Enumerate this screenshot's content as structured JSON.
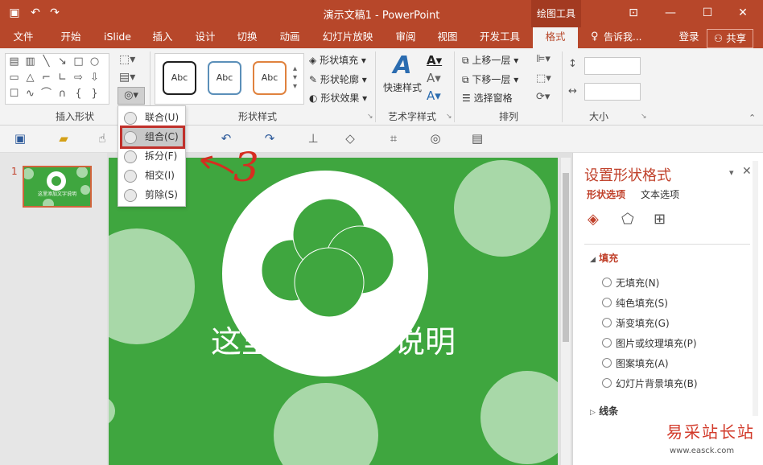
{
  "window": {
    "title": "演示文稿1 - PowerPoint",
    "context_tool": "绘图工具",
    "controls": [
      "restore-ribbon",
      "minimize",
      "maximize",
      "close"
    ]
  },
  "tabs": [
    "文件",
    "开始",
    "iSlide",
    "插入",
    "设计",
    "切换",
    "动画",
    "幻灯片放映",
    "审阅",
    "视图",
    "开发工具",
    "格式"
  ],
  "active_tab": "格式",
  "tellme": "告诉我...",
  "account": {
    "login": "登录",
    "share": "共享"
  },
  "ribbon": {
    "groups": {
      "insert_shapes": "插入形状",
      "shape_styles": "形状样式",
      "wordart_styles": "艺术字样式",
      "arrange": "排列",
      "size": "大小"
    },
    "style_samples": [
      "Abc",
      "Abc",
      "Abc"
    ],
    "style_colors": [
      "#1f1f1f",
      "#5b8fb9",
      "#e0823e"
    ],
    "shape_fill": "形状填充",
    "shape_outline": "形状轮廓",
    "shape_effects": "形状效果",
    "quick_styles": "快速样式",
    "bring_forward": "上移一层",
    "send_backward": "下移一层",
    "selection_pane": "选择窗格"
  },
  "merge_menu": {
    "items": [
      "联合(U)",
      "组合(C)",
      "拆分(F)",
      "相交(I)",
      "剪除(S)"
    ],
    "highlighted": "组合(C)"
  },
  "annotation_number": "3",
  "slides": {
    "current_index": "1"
  },
  "slide": {
    "text": "这里添加文字说明",
    "bg_color": "#3fa63f",
    "light_circle_color": "#a8d8a8"
  },
  "thumb_text": "这里添加文字说明",
  "format_pane": {
    "title": "设置形状格式",
    "tab_shape": "形状选项",
    "tab_text": "文本选项",
    "fill_header": "填充",
    "fill_options": [
      "无填充(N)",
      "纯色填充(S)",
      "渐变填充(G)",
      "图片或纹理填充(P)",
      "图案填充(A)",
      "幻灯片背景填充(B)"
    ],
    "line_header": "线条"
  },
  "watermark": {
    "top": "易采站长站",
    "bottom": "www.easck.com"
  }
}
